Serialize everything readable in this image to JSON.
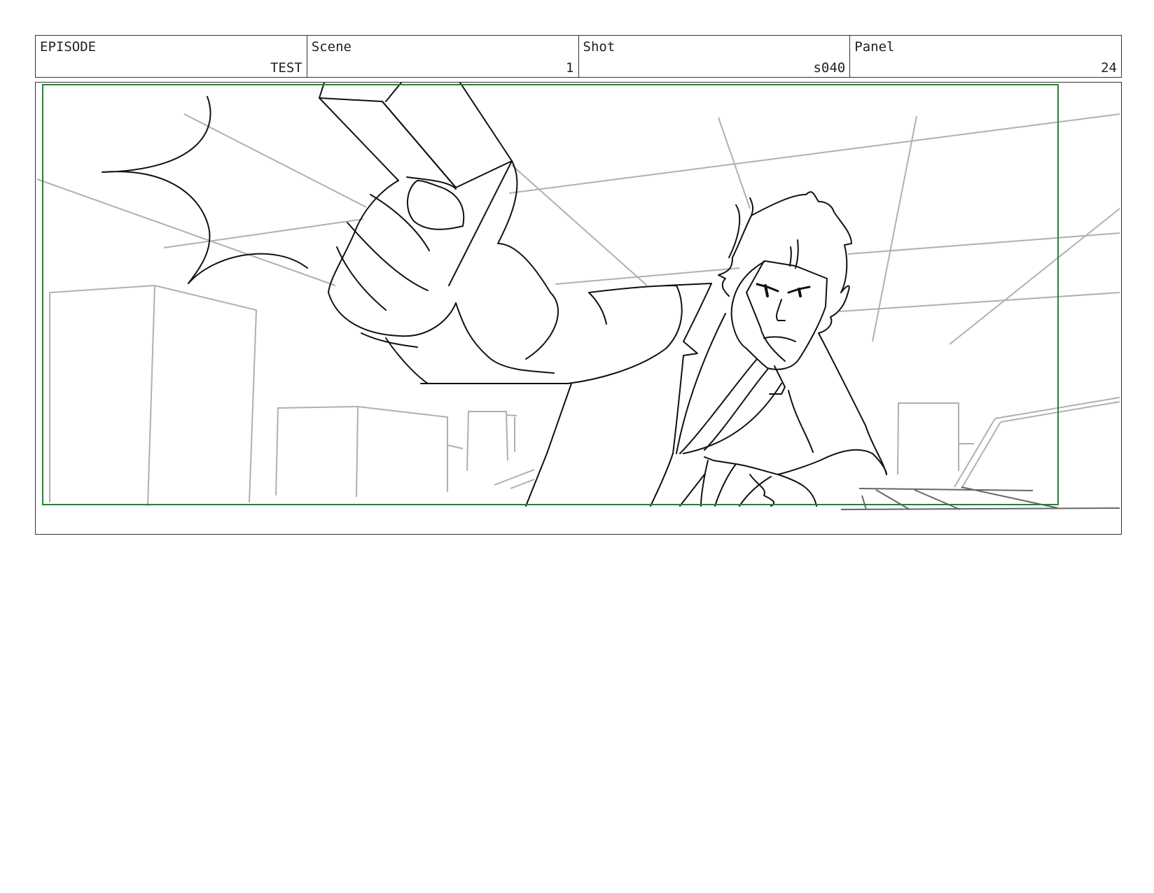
{
  "header": {
    "episode": {
      "label": "EPISODE",
      "value": "TEST"
    },
    "scene": {
      "label": "Scene",
      "value": "1"
    },
    "shot": {
      "label": "Shot",
      "value": "s040"
    },
    "panel": {
      "label": "Panel",
      "value": "24"
    }
  },
  "colors": {
    "safe_frame": "#2e7d32",
    "ink": "#111111",
    "construction": "#b0b0b0"
  }
}
